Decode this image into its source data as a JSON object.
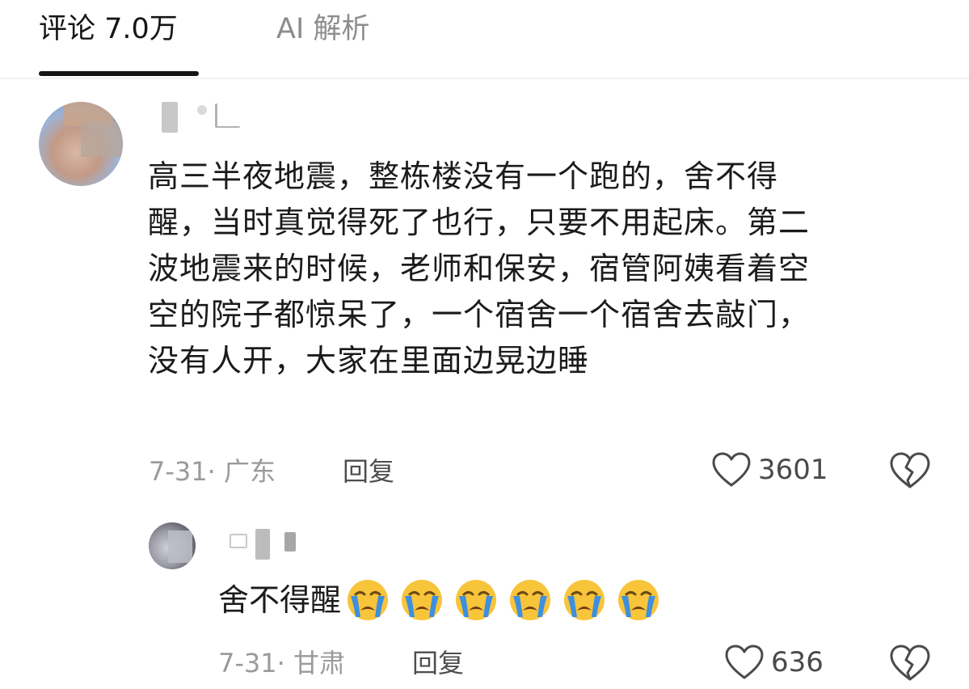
{
  "tabs": {
    "comments_label": "评论 7.0万",
    "ai_label": "AI 解析"
  },
  "comment": {
    "text": "高三半夜地震，整栋楼没有一个跑的，舍不得\n醒，当时真觉得死了也行，只要不用起床。第二\n波地震来的时候，老师和保安，宿管阿姨看着空\n空的院子都惊呆了，一个宿舍一个宿舍去敲门，\n没有人开，大家在里面边晃边睡",
    "date_location": "7-31· 广东",
    "reply_label": "回复",
    "likes": "3601"
  },
  "reply": {
    "text": "舍不得醒",
    "emoji_count": 6,
    "emoji_icon": "loudly-crying-face-icon",
    "date_location": "7-31· 甘肃",
    "reply_label": "回复",
    "likes": "636"
  },
  "colors": {
    "primary_text": "#1b1b1b",
    "secondary_text": "#9a9a9a",
    "emoji_face": "#f8c43a",
    "emoji_tear": "#3d8fe0"
  }
}
